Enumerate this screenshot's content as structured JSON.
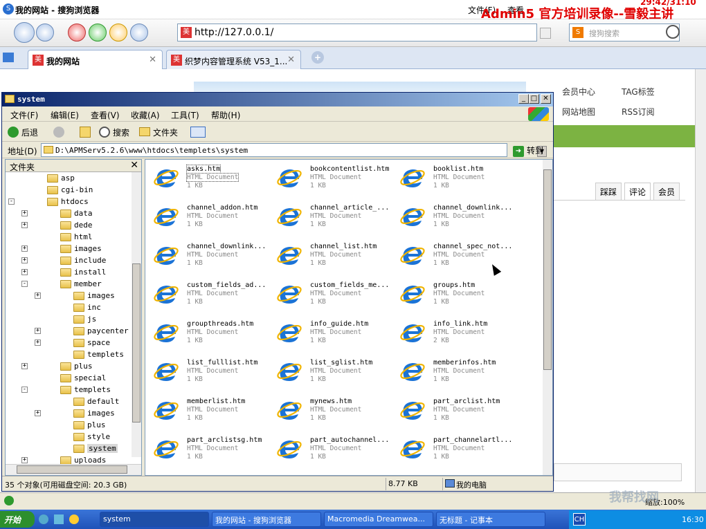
{
  "browser": {
    "title": "我的网站 - 搜狗浏览器",
    "menu_file": "文件(F)",
    "menu_view": "查看",
    "url": "http://127.0.0.1/",
    "search_placeholder": "搜狗搜索",
    "tabs": [
      {
        "label": "我的网站"
      },
      {
        "label": "织梦内容管理系统 V53_1..."
      }
    ],
    "tab_add": "+"
  },
  "overlay": {
    "watermark": "Admin5 官方培训录像--雪毅主讲",
    "time": "29:42/31:10",
    "site_watermark": "我帮找网"
  },
  "page": {
    "links": [
      "会员中心",
      "TAG标签",
      "网站地图",
      "RSS订阅"
    ],
    "tabs": [
      "踩踩",
      "评论",
      "会员"
    ],
    "zoom": "缩放:100%"
  },
  "explorer": {
    "title": "system",
    "menu": [
      "文件(F)",
      "编辑(E)",
      "查看(V)",
      "收藏(A)",
      "工具(T)",
      "帮助(H)"
    ],
    "toolbar": {
      "back": "后退",
      "search": "搜索",
      "folders": "文件夹"
    },
    "address_label": "地址(D)",
    "address": "D:\\APMServ5.2.6\\www\\htdocs\\templets\\system",
    "go": "转到",
    "folder_pane_title": "文件夹",
    "tree": [
      {
        "name": "asp",
        "indent": 0,
        "pm": ""
      },
      {
        "name": "cgi-bin",
        "indent": 0,
        "pm": ""
      },
      {
        "name": "htdocs",
        "indent": 0,
        "pm": "-"
      },
      {
        "name": "data",
        "indent": 1,
        "pm": "+"
      },
      {
        "name": "dede",
        "indent": 1,
        "pm": "+"
      },
      {
        "name": "html",
        "indent": 1,
        "pm": ""
      },
      {
        "name": "images",
        "indent": 1,
        "pm": "+"
      },
      {
        "name": "include",
        "indent": 1,
        "pm": "+"
      },
      {
        "name": "install",
        "indent": 1,
        "pm": "+"
      },
      {
        "name": "member",
        "indent": 1,
        "pm": "-"
      },
      {
        "name": "images",
        "indent": 2,
        "pm": "+"
      },
      {
        "name": "inc",
        "indent": 2,
        "pm": ""
      },
      {
        "name": "js",
        "indent": 2,
        "pm": ""
      },
      {
        "name": "paycenter",
        "indent": 2,
        "pm": "+"
      },
      {
        "name": "space",
        "indent": 2,
        "pm": "+"
      },
      {
        "name": "templets",
        "indent": 2,
        "pm": ""
      },
      {
        "name": "plus",
        "indent": 1,
        "pm": "+"
      },
      {
        "name": "special",
        "indent": 1,
        "pm": ""
      },
      {
        "name": "templets",
        "indent": 1,
        "pm": "-"
      },
      {
        "name": "default",
        "indent": 2,
        "pm": ""
      },
      {
        "name": "images",
        "indent": 2,
        "pm": "+"
      },
      {
        "name": "plus",
        "indent": 2,
        "pm": ""
      },
      {
        "name": "style",
        "indent": 2,
        "pm": ""
      },
      {
        "name": "system",
        "indent": 2,
        "pm": "",
        "selected": true
      },
      {
        "name": "uploads",
        "indent": 1,
        "pm": "+"
      }
    ],
    "files": [
      {
        "name": "asks.htm",
        "type": "HTML Document",
        "size": "1 KB",
        "selected": true
      },
      {
        "name": "bookcontentlist.htm",
        "type": "HTML Document",
        "size": "1 KB"
      },
      {
        "name": "booklist.htm",
        "type": "HTML Document",
        "size": "1 KB"
      },
      {
        "name": "channel_addon.htm",
        "type": "HTML Document",
        "size": "1 KB"
      },
      {
        "name": "channel_article_...",
        "type": "HTML Document",
        "size": "1 KB"
      },
      {
        "name": "channel_downlink...",
        "type": "HTML Document",
        "size": "1 KB"
      },
      {
        "name": "channel_downlink...",
        "type": "HTML Document",
        "size": "1 KB"
      },
      {
        "name": "channel_list.htm",
        "type": "HTML Document",
        "size": "1 KB"
      },
      {
        "name": "channel_spec_not...",
        "type": "HTML Document",
        "size": "1 KB"
      },
      {
        "name": "custom_fields_ad...",
        "type": "HTML Document",
        "size": "1 KB"
      },
      {
        "name": "custom_fields_me...",
        "type": "HTML Document",
        "size": "1 KB"
      },
      {
        "name": "groups.htm",
        "type": "HTML Document",
        "size": "1 KB"
      },
      {
        "name": "groupthreads.htm",
        "type": "HTML Document",
        "size": "1 KB"
      },
      {
        "name": "info_guide.htm",
        "type": "HTML Document",
        "size": "1 KB"
      },
      {
        "name": "info_link.htm",
        "type": "HTML Document",
        "size": "2 KB"
      },
      {
        "name": "list_fulllist.htm",
        "type": "HTML Document",
        "size": "1 KB"
      },
      {
        "name": "list_sglist.htm",
        "type": "HTML Document",
        "size": "1 KB"
      },
      {
        "name": "memberinfos.htm",
        "type": "HTML Document",
        "size": "1 KB"
      },
      {
        "name": "memberlist.htm",
        "type": "HTML Document",
        "size": "1 KB"
      },
      {
        "name": "mynews.htm",
        "type": "HTML Document",
        "size": "1 KB"
      },
      {
        "name": "part_arclist.htm",
        "type": "HTML Document",
        "size": "1 KB"
      },
      {
        "name": "part_arclistsg.htm",
        "type": "HTML Document",
        "size": "1 KB"
      },
      {
        "name": "part_autochannel...",
        "type": "HTML Document",
        "size": "1 KB"
      },
      {
        "name": "part_channelartl...",
        "type": "HTML Document",
        "size": "1 KB"
      }
    ],
    "status_left": "35 个对象(可用磁盘空间: 20.3 GB)",
    "status_size": "8.77 KB",
    "status_location": "我的电脑"
  },
  "taskbar": {
    "start": "开始",
    "buttons": [
      "system",
      "我的网站 - 搜狗浏览器",
      "Macromedia Dreamwea...",
      "无标题 - 记事本"
    ],
    "ime": "CH",
    "clock": "16:30"
  },
  "colors": {
    "title_bar": "#0a246a",
    "taskbar": "#1f52b8",
    "watermark": "#e00000",
    "ie_blue": "#1b73d6"
  }
}
